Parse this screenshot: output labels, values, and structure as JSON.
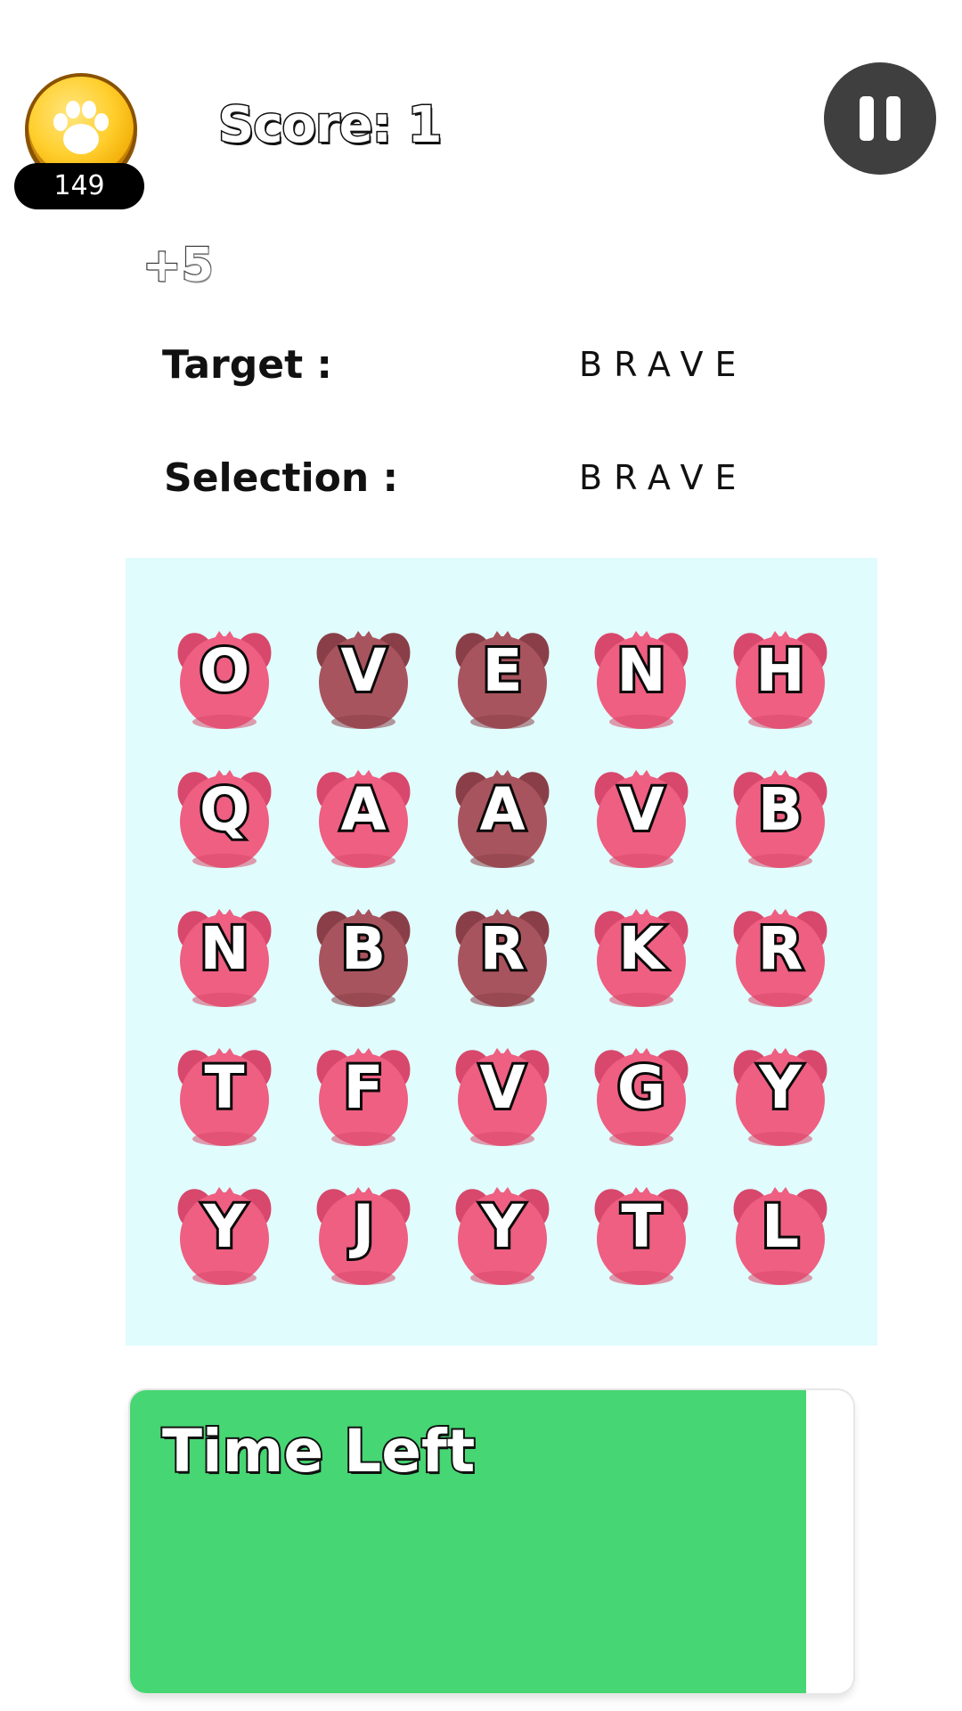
{
  "hud": {
    "coins": "149",
    "score_text": "Score: 1",
    "bonus_text": "+5"
  },
  "target": {
    "label": "Target :",
    "word": "BRAVE"
  },
  "selection": {
    "label": "Selection :",
    "word": "BRAVE"
  },
  "grid": {
    "rows": [
      [
        {
          "letter": "O",
          "selected": false
        },
        {
          "letter": "V",
          "selected": true
        },
        {
          "letter": "E",
          "selected": true
        },
        {
          "letter": "N",
          "selected": false
        },
        {
          "letter": "H",
          "selected": false
        }
      ],
      [
        {
          "letter": "Q",
          "selected": false
        },
        {
          "letter": "A",
          "selected": false
        },
        {
          "letter": "A",
          "selected": true
        },
        {
          "letter": "V",
          "selected": false
        },
        {
          "letter": "B",
          "selected": false
        }
      ],
      [
        {
          "letter": "N",
          "selected": false
        },
        {
          "letter": "B",
          "selected": true
        },
        {
          "letter": "R",
          "selected": true
        },
        {
          "letter": "K",
          "selected": false
        },
        {
          "letter": "R",
          "selected": false
        }
      ],
      [
        {
          "letter": "T",
          "selected": false
        },
        {
          "letter": "F",
          "selected": false
        },
        {
          "letter": "V",
          "selected": false
        },
        {
          "letter": "G",
          "selected": false
        },
        {
          "letter": "Y",
          "selected": false
        }
      ],
      [
        {
          "letter": "Y",
          "selected": false
        },
        {
          "letter": "J",
          "selected": false
        },
        {
          "letter": "Y",
          "selected": false
        },
        {
          "letter": "T",
          "selected": false
        },
        {
          "letter": "L",
          "selected": false
        }
      ]
    ]
  },
  "timer": {
    "label": "Time Left",
    "remaining_fraction": 0.935
  },
  "colors": {
    "tile": "#ee5f82",
    "tile_selected": "#a8545e",
    "grid_bg": "#e0fcfd",
    "timer_fill": "#46d673",
    "pause_bg": "#3f3f3f"
  },
  "icons": {
    "coin": "paw-print-icon",
    "pause": "pause-icon"
  }
}
